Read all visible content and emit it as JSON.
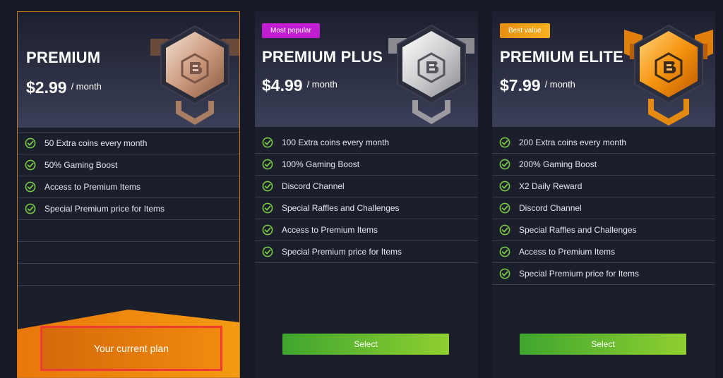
{
  "colors": {
    "background": "#171a26",
    "card": "#1b1e2b",
    "premium_border": "#c77a1c",
    "check_green": "#7ac943",
    "select_green": "#7cc435",
    "most_popular_tag": "#c21ed1",
    "best_value_tag": "#f0a21a",
    "current_plan_orange": "#f08a0e",
    "highlight_red": "#ee3b33"
  },
  "plans": [
    {
      "name": "PREMIUM",
      "price": "$2.99",
      "period": "/ month",
      "badge_icon": "bronze-hexagon-badge",
      "features": [
        "50 Extra coins every month",
        "50% Gaming Boost",
        "Access to Premium Items",
        "Special Premium price for Items"
      ],
      "button": "Your current plan"
    },
    {
      "name": "PREMIUM PLUS",
      "price": "$4.99",
      "period": "/ month",
      "tag": "Most popular",
      "badge_icon": "silver-hexagon-badge",
      "features": [
        "100 Extra coins every month",
        "100% Gaming Boost",
        "Discord Channel",
        "Special Raffles and Challenges",
        "Access to Premium Items",
        "Special Premium price for Items"
      ],
      "button": "Select"
    },
    {
      "name": "PREMIUM ELITE",
      "price": "$7.99",
      "period": "/ month",
      "tag": "Best value",
      "badge_icon": "gold-hexagon-badge",
      "features": [
        "200 Extra coins every month",
        "200% Gaming Boost",
        "X2 Daily Reward",
        "Discord Channel",
        "Special Raffles and Challenges",
        "Access to Premium Items",
        "Special Premium price for Items"
      ],
      "button": "Select"
    }
  ]
}
